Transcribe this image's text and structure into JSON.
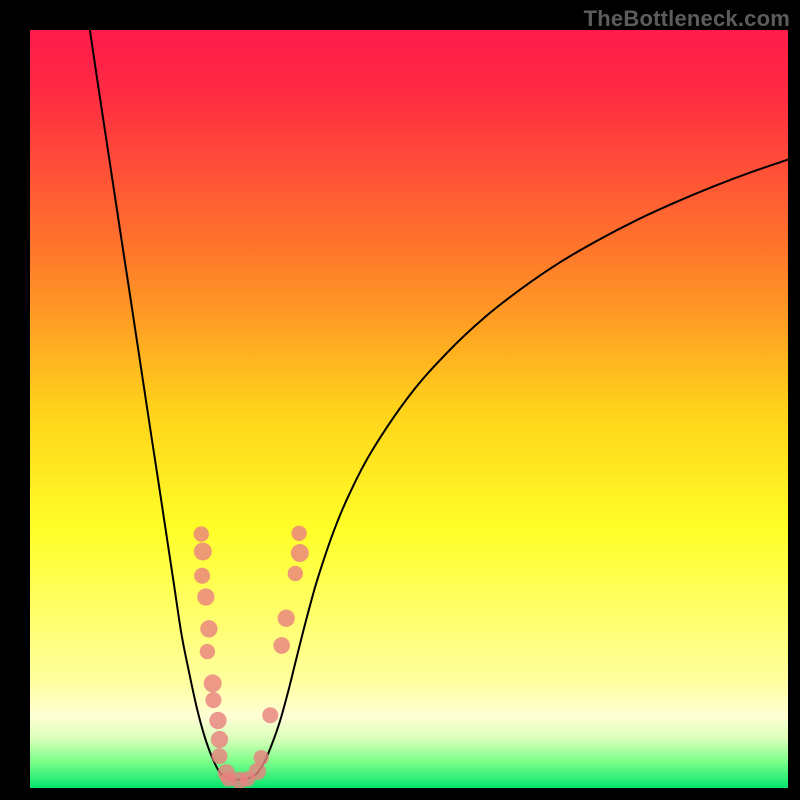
{
  "watermark": "TheBottleneck.com",
  "chart_data": {
    "type": "line",
    "title": "",
    "xlabel": "",
    "ylabel": "",
    "xlim": [
      0,
      100
    ],
    "ylim": [
      0,
      100
    ],
    "grid": false,
    "background_gradient": {
      "stops": [
        {
          "offset": 0.0,
          "color": "#ff1b4a"
        },
        {
          "offset": 0.08,
          "color": "#ff2a43"
        },
        {
          "offset": 0.3,
          "color": "#ff7a2a"
        },
        {
          "offset": 0.5,
          "color": "#ffd21a"
        },
        {
          "offset": 0.66,
          "color": "#ffff28"
        },
        {
          "offset": 0.86,
          "color": "#ffffa0"
        },
        {
          "offset": 0.905,
          "color": "#ffffd5"
        },
        {
          "offset": 0.935,
          "color": "#d9ffba"
        },
        {
          "offset": 0.965,
          "color": "#7dff8a"
        },
        {
          "offset": 1.0,
          "color": "#05e56e"
        }
      ]
    },
    "series": [
      {
        "name": "left-branch",
        "x": [
          7.9,
          9.0,
          10.0,
          11.0,
          12.0,
          13.0,
          14.0,
          15.0,
          16.0,
          17.0,
          18.0,
          19.0,
          20.0,
          21.0,
          22.0,
          23.0,
          24.0,
          25.0,
          25.7
        ],
        "y": [
          100.0,
          92.6,
          86.0,
          79.4,
          72.8,
          66.3,
          59.7,
          53.1,
          46.5,
          40.0,
          33.4,
          26.8,
          20.2,
          15.2,
          10.6,
          6.9,
          4.1,
          2.1,
          1.5
        ]
      },
      {
        "name": "valley-floor",
        "x": [
          25.7,
          26.5,
          27.5,
          28.5,
          29.3
        ],
        "y": [
          1.5,
          1.2,
          1.1,
          1.2,
          1.5
        ]
      },
      {
        "name": "right-branch",
        "x": [
          29.3,
          30.0,
          31.0,
          32.0,
          33.0,
          34.0,
          35.0,
          36.0,
          37.0,
          38.0,
          40.0,
          42.0,
          45.0,
          50.0,
          55.0,
          60.0,
          65.0,
          70.0,
          75.0,
          80.0,
          85.0,
          90.0,
          95.0,
          100.0
        ],
        "y": [
          1.5,
          2.0,
          3.6,
          6.0,
          8.9,
          12.5,
          16.5,
          20.5,
          24.3,
          27.8,
          33.7,
          38.5,
          44.3,
          51.7,
          57.4,
          62.1,
          66.0,
          69.4,
          72.3,
          74.9,
          77.2,
          79.3,
          81.2,
          82.9
        ]
      }
    ],
    "markers": {
      "name": "highlight-dots",
      "points": [
        {
          "x": 22.6,
          "y": 33.5,
          "r": 1.0
        },
        {
          "x": 22.8,
          "y": 31.2,
          "r": 1.4
        },
        {
          "x": 22.7,
          "y": 28.0,
          "r": 1.1
        },
        {
          "x": 23.2,
          "y": 25.2,
          "r": 1.3
        },
        {
          "x": 23.6,
          "y": 21.0,
          "r": 1.3
        },
        {
          "x": 23.4,
          "y": 18.0,
          "r": 1.0
        },
        {
          "x": 24.1,
          "y": 13.8,
          "r": 1.4
        },
        {
          "x": 24.2,
          "y": 11.6,
          "r": 1.1
        },
        {
          "x": 24.8,
          "y": 8.9,
          "r": 1.3
        },
        {
          "x": 25.0,
          "y": 6.4,
          "r": 1.3
        },
        {
          "x": 25.0,
          "y": 4.2,
          "r": 1.1
        },
        {
          "x": 25.9,
          "y": 2.0,
          "r": 1.3
        },
        {
          "x": 26.2,
          "y": 1.2,
          "r": 1.0
        },
        {
          "x": 27.6,
          "y": 1.0,
          "r": 1.3
        },
        {
          "x": 28.7,
          "y": 1.2,
          "r": 1.0
        },
        {
          "x": 30.0,
          "y": 2.2,
          "r": 1.3
        },
        {
          "x": 30.5,
          "y": 4.0,
          "r": 1.0
        },
        {
          "x": 31.7,
          "y": 9.6,
          "r": 1.1
        },
        {
          "x": 33.2,
          "y": 18.8,
          "r": 1.2
        },
        {
          "x": 33.8,
          "y": 22.4,
          "r": 1.3
        },
        {
          "x": 35.0,
          "y": 28.3,
          "r": 1.0
        },
        {
          "x": 35.6,
          "y": 31.0,
          "r": 1.4
        },
        {
          "x": 35.5,
          "y": 33.6,
          "r": 1.0
        }
      ]
    }
  }
}
